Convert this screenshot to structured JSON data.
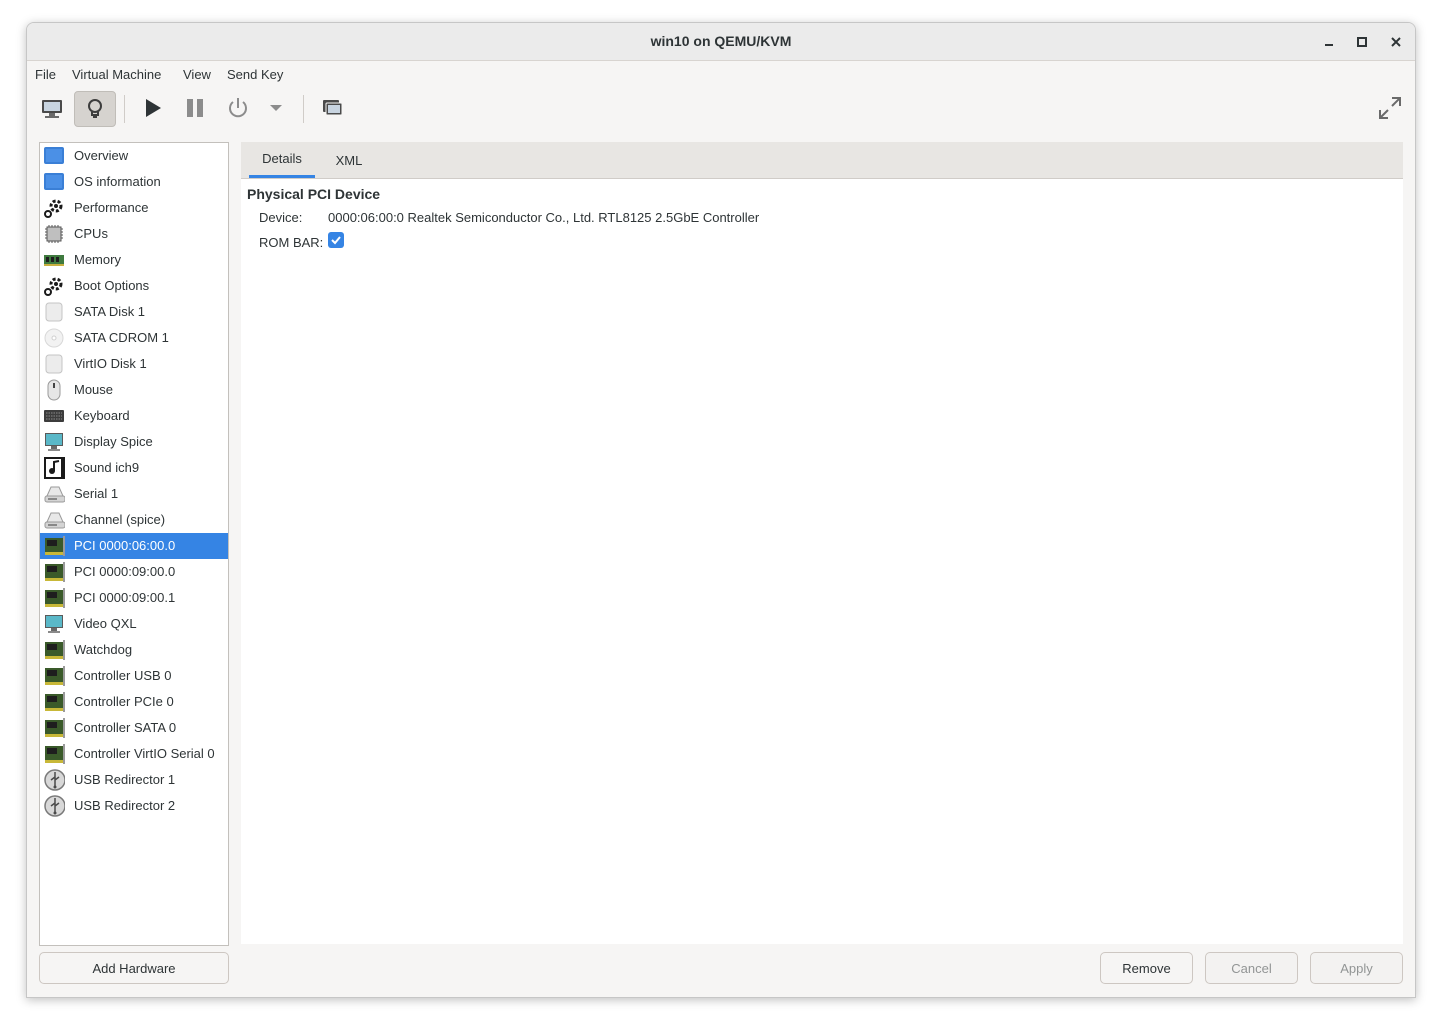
{
  "window": {
    "title": "win10 on QEMU/KVM"
  },
  "menubar": {
    "items": [
      "File",
      "Virtual Machine",
      "View",
      "Send Key"
    ]
  },
  "toolbar": {
    "buttons": [
      "console-view",
      "details-view",
      "run",
      "pause",
      "shutdown",
      "shutdown-menu",
      "snapshots",
      "fullscreen"
    ]
  },
  "sidebar": {
    "items": [
      {
        "label": "Overview",
        "icon": "monitor-icon"
      },
      {
        "label": "OS information",
        "icon": "monitor-icon"
      },
      {
        "label": "Performance",
        "icon": "gear-icon"
      },
      {
        "label": "CPUs",
        "icon": "cpu-icon"
      },
      {
        "label": "Memory",
        "icon": "memory-icon"
      },
      {
        "label": "Boot Options",
        "icon": "gear-icon"
      },
      {
        "label": "SATA Disk 1",
        "icon": "disk-icon"
      },
      {
        "label": "SATA CDROM 1",
        "icon": "cdrom-icon"
      },
      {
        "label": "VirtIO Disk 1",
        "icon": "disk-icon"
      },
      {
        "label": "Mouse",
        "icon": "mouse-icon"
      },
      {
        "label": "Keyboard",
        "icon": "keyboard-icon"
      },
      {
        "label": "Display Spice",
        "icon": "display-icon"
      },
      {
        "label": "Sound ich9",
        "icon": "sound-icon"
      },
      {
        "label": "Serial 1",
        "icon": "serial-icon"
      },
      {
        "label": "Channel (spice)",
        "icon": "serial-icon"
      },
      {
        "label": "PCI 0000:06:00.0",
        "icon": "pci-card-icon",
        "selected": true
      },
      {
        "label": "PCI 0000:09:00.0",
        "icon": "pci-card-icon"
      },
      {
        "label": "PCI 0000:09:00.1",
        "icon": "pci-card-icon"
      },
      {
        "label": "Video QXL",
        "icon": "display-icon"
      },
      {
        "label": "Watchdog",
        "icon": "pci-card-icon"
      },
      {
        "label": "Controller USB 0",
        "icon": "pci-card-icon"
      },
      {
        "label": "Controller PCIe 0",
        "icon": "pci-card-icon"
      },
      {
        "label": "Controller SATA 0",
        "icon": "pci-card-icon"
      },
      {
        "label": "Controller VirtIO Serial 0",
        "icon": "pci-card-icon"
      },
      {
        "label": "USB Redirector 1",
        "icon": "usb-icon"
      },
      {
        "label": "USB Redirector 2",
        "icon": "usb-icon"
      }
    ],
    "add_hardware_label": "Add Hardware"
  },
  "content": {
    "tabs": [
      "Details",
      "XML"
    ],
    "active_tab": "Details",
    "section_title": "Physical PCI Device",
    "device_label": "Device:",
    "device_value": "0000:06:00:0 Realtek Semiconductor Co., Ltd. RTL8125 2.5GbE Controller",
    "rom_bar_label": "ROM BAR:",
    "rom_bar_checked": true
  },
  "buttons": {
    "remove": "Remove",
    "cancel": "Cancel",
    "apply": "Apply"
  },
  "colors": {
    "accent": "#3584e4",
    "window_bg": "#f6f5f4",
    "titlebar_bg": "#ebebeb"
  }
}
